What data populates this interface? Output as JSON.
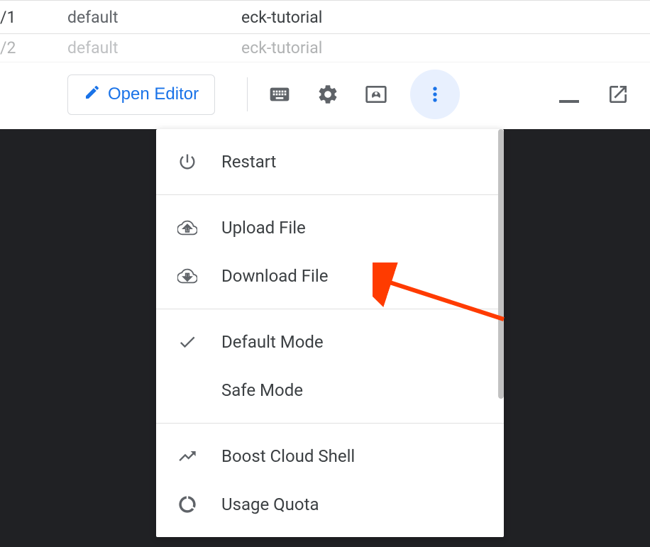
{
  "table": {
    "rows": [
      {
        "col1": "/1",
        "col2": "default",
        "col3": "eck-tutorial"
      },
      {
        "col1": "/2",
        "col2": "default",
        "col3": "eck-tutorial"
      }
    ]
  },
  "toolbar": {
    "open_editor_label": "Open Editor"
  },
  "menu": {
    "restart_label": "Restart",
    "upload_label": "Upload File",
    "download_label": "Download File",
    "default_mode_label": "Default Mode",
    "safe_mode_label": "Safe Mode",
    "boost_label": "Boost Cloud Shell",
    "usage_quota_label": "Usage Quota"
  }
}
